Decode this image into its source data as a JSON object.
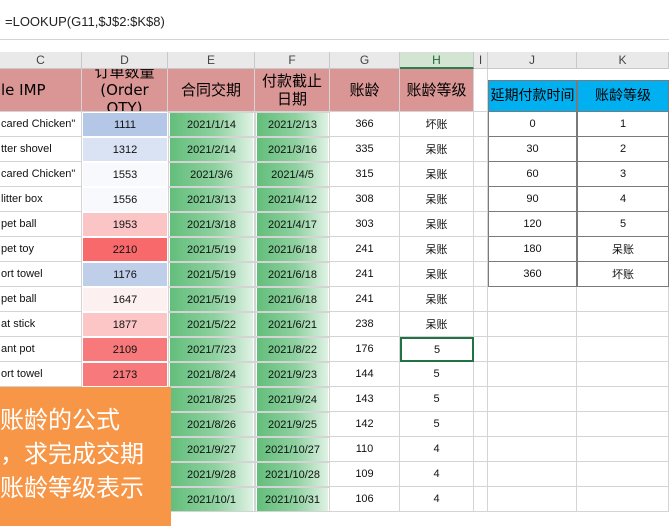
{
  "formula_bar": {
    "text": "=LOOKUP(G11,$J$2:$K$8)"
  },
  "columns": [
    "C",
    "D",
    "E",
    "F",
    "G",
    "H",
    "I",
    "J",
    "K"
  ],
  "selected_column": "H",
  "headers": {
    "c": "le IMP",
    "d": "订单数量 (Order QTY)",
    "e": "合同交期",
    "f": "付款截止日期",
    "g": "账龄",
    "h": "账龄等级"
  },
  "rows": [
    {
      "c": "cared Chicken\"",
      "d": "1111",
      "e": "2021/1/14",
      "f": "2021/2/13",
      "g": "366",
      "h": "坏账"
    },
    {
      "c": "tter shovel",
      "d": "1312",
      "e": "2021/2/14",
      "f": "2021/3/16",
      "g": "335",
      "h": "呆账"
    },
    {
      "c": "cared Chicken\"",
      "d": "1553",
      "e": "2021/3/6",
      "f": "2021/4/5",
      "g": "315",
      "h": "呆账"
    },
    {
      "c": " litter box",
      "d": "1556",
      "e": "2021/3/13",
      "f": "2021/4/12",
      "g": "308",
      "h": "呆账"
    },
    {
      "c": "pet ball",
      "d": "1953",
      "e": "2021/3/18",
      "f": "2021/4/17",
      "g": "303",
      "h": "呆账"
    },
    {
      "c": "pet toy",
      "d": "2210",
      "e": "2021/5/19",
      "f": "2021/6/18",
      "g": "241",
      "h": "呆账"
    },
    {
      "c": "ort towel",
      "d": "1176",
      "e": "2021/5/19",
      "f": "2021/6/18",
      "g": "241",
      "h": "呆账"
    },
    {
      "c": "pet ball",
      "d": "1647",
      "e": "2021/5/19",
      "f": "2021/6/18",
      "g": "241",
      "h": "呆账"
    },
    {
      "c": "at stick",
      "d": "1877",
      "e": "2021/5/22",
      "f": "2021/6/21",
      "g": "238",
      "h": "呆账"
    },
    {
      "c": "ant pot",
      "d": "2109",
      "e": "2021/7/23",
      "f": "2021/8/22",
      "g": "176",
      "h": "5"
    },
    {
      "c": "ort towel",
      "d": "2173",
      "e": "2021/8/24",
      "f": "2021/9/23",
      "g": "144",
      "h": "5"
    },
    {
      "c": "",
      "d": "",
      "e": "2021/8/25",
      "f": "2021/9/24",
      "g": "143",
      "h": "5"
    },
    {
      "c": "",
      "d": "",
      "e": "2021/8/26",
      "f": "2021/9/25",
      "g": "142",
      "h": "5"
    },
    {
      "c": "",
      "d": "",
      "e": "2021/9/27",
      "f": "2021/10/27",
      "g": "110",
      "h": "4"
    },
    {
      "c": "",
      "d": "",
      "e": "2021/9/28",
      "f": "2021/10/28",
      "g": "109",
      "h": "4"
    },
    {
      "c": "",
      "d": "",
      "e": "2021/10/1",
      "f": "2021/10/31",
      "g": "106",
      "h": "4"
    }
  ],
  "d_colors": [
    "#b4c7e7",
    "#dae3f3",
    "#f7f9fd",
    "#f8f9fd",
    "#fbc4c5",
    "#f8696b",
    "#bfcfea",
    "#fdf0f1",
    "#fcc6c7",
    "#f8797b",
    "#f8797b"
  ],
  "lookup_table": {
    "headers": {
      "j": "延期付款时间",
      "k": "账龄等级"
    },
    "rows": [
      {
        "j": "0",
        "k": "1"
      },
      {
        "j": "30",
        "k": "2"
      },
      {
        "j": "60",
        "k": "3"
      },
      {
        "j": "90",
        "k": "4"
      },
      {
        "j": "120",
        "k": "5"
      },
      {
        "j": "180",
        "k": "呆账"
      },
      {
        "j": "360",
        "k": "坏账"
      }
    ]
  },
  "note": {
    "line1": "账龄的公式",
    "line2": "，求完成交期",
    "line3": "账龄等级表示"
  }
}
